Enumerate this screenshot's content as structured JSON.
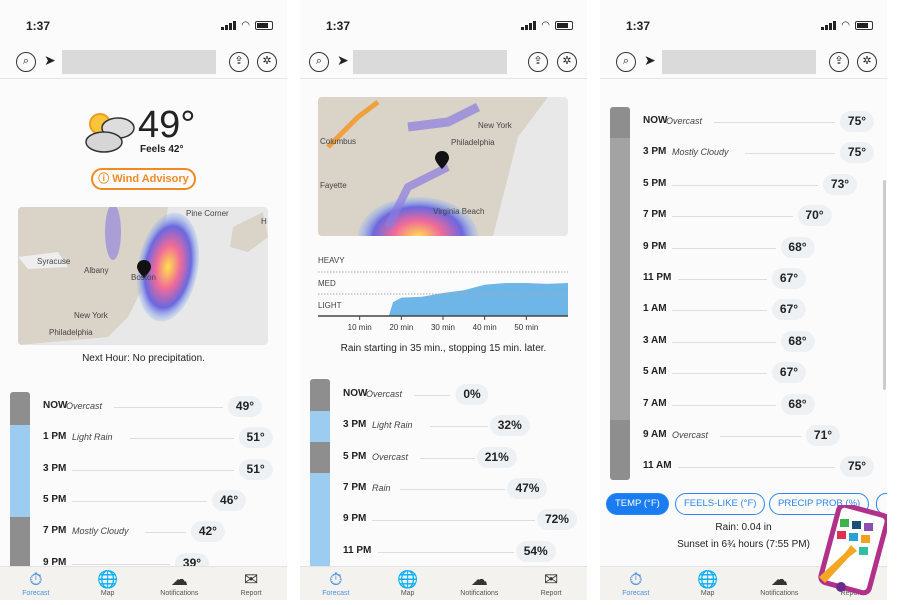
{
  "status_time": "1:37",
  "tabs": [
    {
      "label": "Forecast",
      "icon": "stopwatch-icon"
    },
    {
      "label": "Map",
      "icon": "globe-icon"
    },
    {
      "label": "Notifications",
      "icon": "cloud-alert-icon"
    },
    {
      "label": "Report",
      "icon": "envelope-icon"
    }
  ],
  "colors": {
    "accent": "#1a7cf0",
    "advisory": "#f08a24",
    "rain_fill": "#6fb6e8",
    "overcast_bar": "#8e8e8e",
    "rain_bar": "#9ccdf1"
  },
  "panel1": {
    "temp": "49°",
    "feels": "Feels 42°",
    "advisory": "Wind Advisory",
    "map_labels": [
      "Pine Corner",
      "H",
      "Syracuse",
      "Albany",
      "Boston",
      "New York",
      "Philadelphia"
    ],
    "next_hour": "Next Hour: No precipitation.",
    "rows": [
      {
        "time": "NOW",
        "cond": "Overcast",
        "value": 49,
        "label": "49°"
      },
      {
        "time": "1 PM",
        "cond": "Light Rain",
        "value": 51,
        "label": "51°"
      },
      {
        "time": "3 PM",
        "cond": "",
        "value": 51,
        "label": "51°"
      },
      {
        "time": "5 PM",
        "cond": "",
        "value": 46,
        "label": "46°"
      },
      {
        "time": "7 PM",
        "cond": "Mostly Cloudy",
        "value": 42,
        "label": "42°"
      },
      {
        "time": "9 PM",
        "cond": "",
        "value": 39,
        "label": "39°"
      }
    ]
  },
  "panel2": {
    "map_labels": [
      "New York",
      "Columbus",
      "Philadelphia",
      "Fayette",
      "Virginia Beach"
    ],
    "chart_data": {
      "type": "area",
      "levels": [
        "HEAVY",
        "MED",
        "LIGHT"
      ],
      "x_ticks": [
        "10 min",
        "20 min",
        "30 min",
        "40 min",
        "50 min"
      ],
      "x": [
        0,
        17,
        18,
        20,
        25,
        30,
        35,
        40,
        45,
        50,
        55,
        60
      ],
      "y": [
        0,
        0,
        0.3,
        0.4,
        0.42,
        0.5,
        0.56,
        0.68,
        0.72,
        0.72,
        0.7,
        0.72
      ]
    },
    "summary": "Rain starting in 35 min., stopping 15 min. later.",
    "rows": [
      {
        "time": "NOW",
        "cond": "Overcast",
        "value": 0,
        "label": "0%"
      },
      {
        "time": "3 PM",
        "cond": "Light Rain",
        "value": 32,
        "label": "32%"
      },
      {
        "time": "5 PM",
        "cond": "Overcast",
        "value": 21,
        "label": "21%"
      },
      {
        "time": "7 PM",
        "cond": "Rain",
        "value": 47,
        "label": "47%"
      },
      {
        "time": "9 PM",
        "cond": "",
        "value": 72,
        "label": "72%"
      },
      {
        "time": "11 PM",
        "cond": "",
        "value": 54,
        "label": "54%"
      }
    ]
  },
  "panel3": {
    "rows": [
      {
        "time": "NOW",
        "cond": "Overcast",
        "value": 75,
        "label": "75°"
      },
      {
        "time": "3 PM",
        "cond": "Mostly Cloudy",
        "value": 75,
        "label": "75°"
      },
      {
        "time": "5 PM",
        "cond": "",
        "value": 73,
        "label": "73°"
      },
      {
        "time": "7 PM",
        "cond": "",
        "value": 70,
        "label": "70°"
      },
      {
        "time": "9 PM",
        "cond": "",
        "value": 68,
        "label": "68°"
      },
      {
        "time": "11 PM",
        "cond": "",
        "value": 67,
        "label": "67°"
      },
      {
        "time": "1 AM",
        "cond": "",
        "value": 67,
        "label": "67°"
      },
      {
        "time": "3 AM",
        "cond": "",
        "value": 68,
        "label": "68°"
      },
      {
        "time": "5 AM",
        "cond": "",
        "value": 67,
        "label": "67°"
      },
      {
        "time": "7 AM",
        "cond": "",
        "value": 68,
        "label": "68°"
      },
      {
        "time": "9 AM",
        "cond": "Overcast",
        "value": 71,
        "label": "71°"
      },
      {
        "time": "11 AM",
        "cond": "",
        "value": 75,
        "label": "75°"
      }
    ],
    "buttons": [
      {
        "label": "TEMP (°F)",
        "active": true
      },
      {
        "label": "FEELS-LIKE (°F)",
        "active": false
      },
      {
        "label": "PRECIP PROB (%)",
        "active": false
      }
    ],
    "rain": "Rain: 0.04 in",
    "sunset": "Sunset in 6¾ hours (7:55 PM)"
  }
}
